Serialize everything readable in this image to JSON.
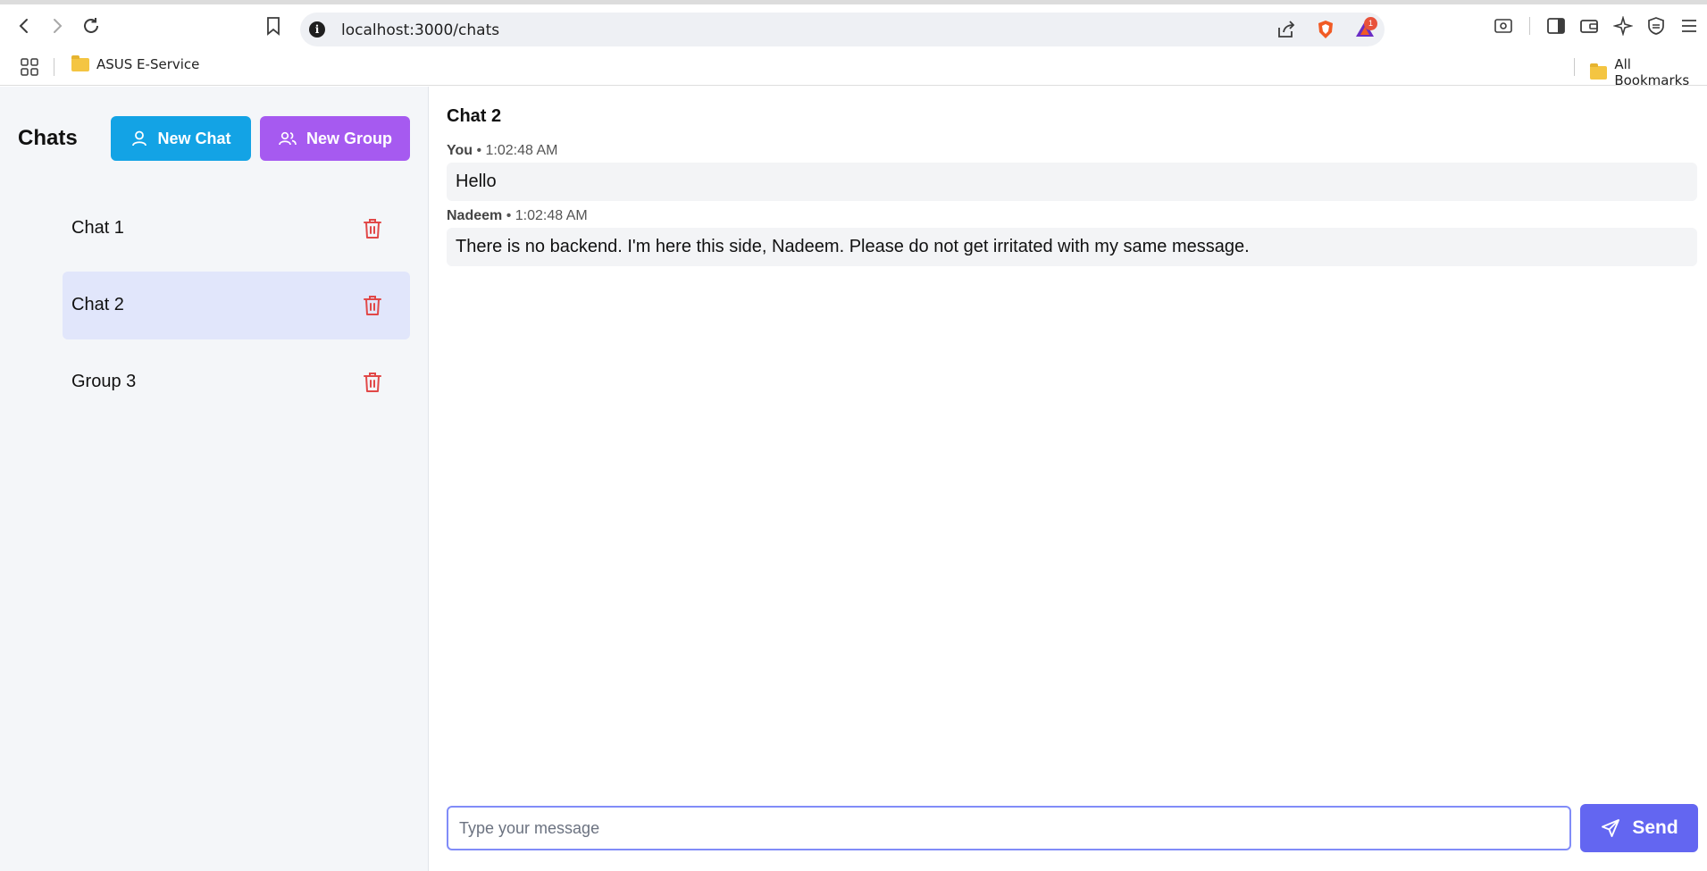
{
  "browser": {
    "url": "localhost:3000/chats",
    "badge_count": "1",
    "bookmarks": {
      "left_item": "ASUS E-Service",
      "right_item": "All Bookmarks"
    }
  },
  "sidebar": {
    "title": "Chats",
    "new_chat_label": "New Chat",
    "new_group_label": "New Group",
    "chats": [
      {
        "label": "Chat 1",
        "active": false
      },
      {
        "label": "Chat 2",
        "active": true
      },
      {
        "label": "Group 3",
        "active": false
      }
    ]
  },
  "conversation": {
    "title": "Chat 2",
    "messages": [
      {
        "sender": "You",
        "separator": " • ",
        "time": "1:02:48 AM",
        "text": "Hello"
      },
      {
        "sender": "Nadeem",
        "separator": " • ",
        "time": "1:02:48 AM",
        "text": "There is no backend. I'm here this side, Nadeem. Please do not get irritated with my same message."
      }
    ],
    "composer": {
      "placeholder": "Type your message",
      "value": "",
      "send_label": "Send"
    }
  },
  "colors": {
    "new_chat_button": "#13a3e5",
    "new_group_button": "#a65af0",
    "send_button": "#6366f1",
    "active_chat_bg": "#e1e6fb",
    "trash_icon": "#e14848"
  }
}
